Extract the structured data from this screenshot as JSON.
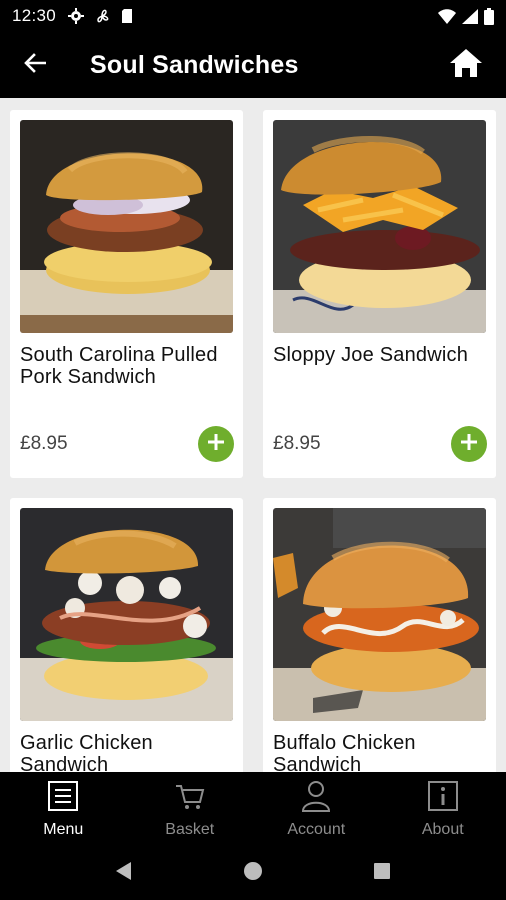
{
  "status": {
    "time": "12:30",
    "icons_left": [
      "gear-icon",
      "fan-icon",
      "sim-icon"
    ],
    "icons_right": [
      "wifi-icon",
      "signal-icon",
      "battery-icon"
    ]
  },
  "header": {
    "title": "Soul Sandwiches",
    "back_icon": "arrow-left-icon",
    "home_icon": "home-icon"
  },
  "products": [
    {
      "name": "South Carolina Pulled Pork Sandwich",
      "price": "£8.95",
      "image": "pulled-pork-burger"
    },
    {
      "name": "Sloppy Joe Sandwich",
      "price": "£8.95",
      "image": "sloppy-joe-burger"
    },
    {
      "name": "Garlic Chicken Sandwich",
      "price": "",
      "image": "garlic-chicken-burger"
    },
    {
      "name": "Buffalo Chicken Sandwich",
      "price": "",
      "image": "buffalo-chicken-burger"
    }
  ],
  "bottom_nav": [
    {
      "label": "Menu",
      "icon": "menu-icon",
      "active": true
    },
    {
      "label": "Basket",
      "icon": "basket-icon",
      "active": false
    },
    {
      "label": "Account",
      "icon": "account-icon",
      "active": false
    },
    {
      "label": "About",
      "icon": "info-icon",
      "active": false
    }
  ],
  "colors": {
    "accent_green": "#6fae2d",
    "bar_background": "#000000",
    "content_background": "#ececec",
    "nav_inactive": "#8d8d8d"
  }
}
